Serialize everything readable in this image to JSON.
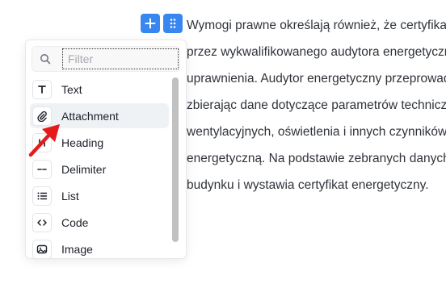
{
  "editor": {
    "lines": [
      "Wymogi prawne określają również, że certyfikat",
      "przez wykwalifikowanego audytora energetycznego",
      "uprawnienia. Audytor energetyczny przeprowadza",
      "zbierając dane dotyczące parametrów technicznych",
      "wentylacyjnych, oświetlenia i innych czynników",
      "energetyczną. Na podstawie zebranych danych",
      "budynku i wystawia certyfikat energetyczny."
    ]
  },
  "toolbar": {
    "plus_icon": "plus-icon",
    "drag_icon": "drag-handle-icon"
  },
  "popover": {
    "search": {
      "placeholder": "Filter",
      "value": ""
    },
    "items": [
      {
        "label": "Text",
        "icon": "T"
      },
      {
        "label": "Attachment",
        "icon": "paperclip-icon",
        "focused": true
      },
      {
        "label": "Heading",
        "icon": "heading-icon"
      },
      {
        "label": "Delimiter",
        "icon": "delimiter-icon"
      },
      {
        "label": "List",
        "icon": "list-icon"
      },
      {
        "label": "Code",
        "icon": "code-icon"
      },
      {
        "label": "Image",
        "icon": "image-icon"
      }
    ]
  },
  "colors": {
    "accent": "#3886f0",
    "focus_bg": "#eff2f5",
    "annotation_arrow": "#e51b1b"
  }
}
